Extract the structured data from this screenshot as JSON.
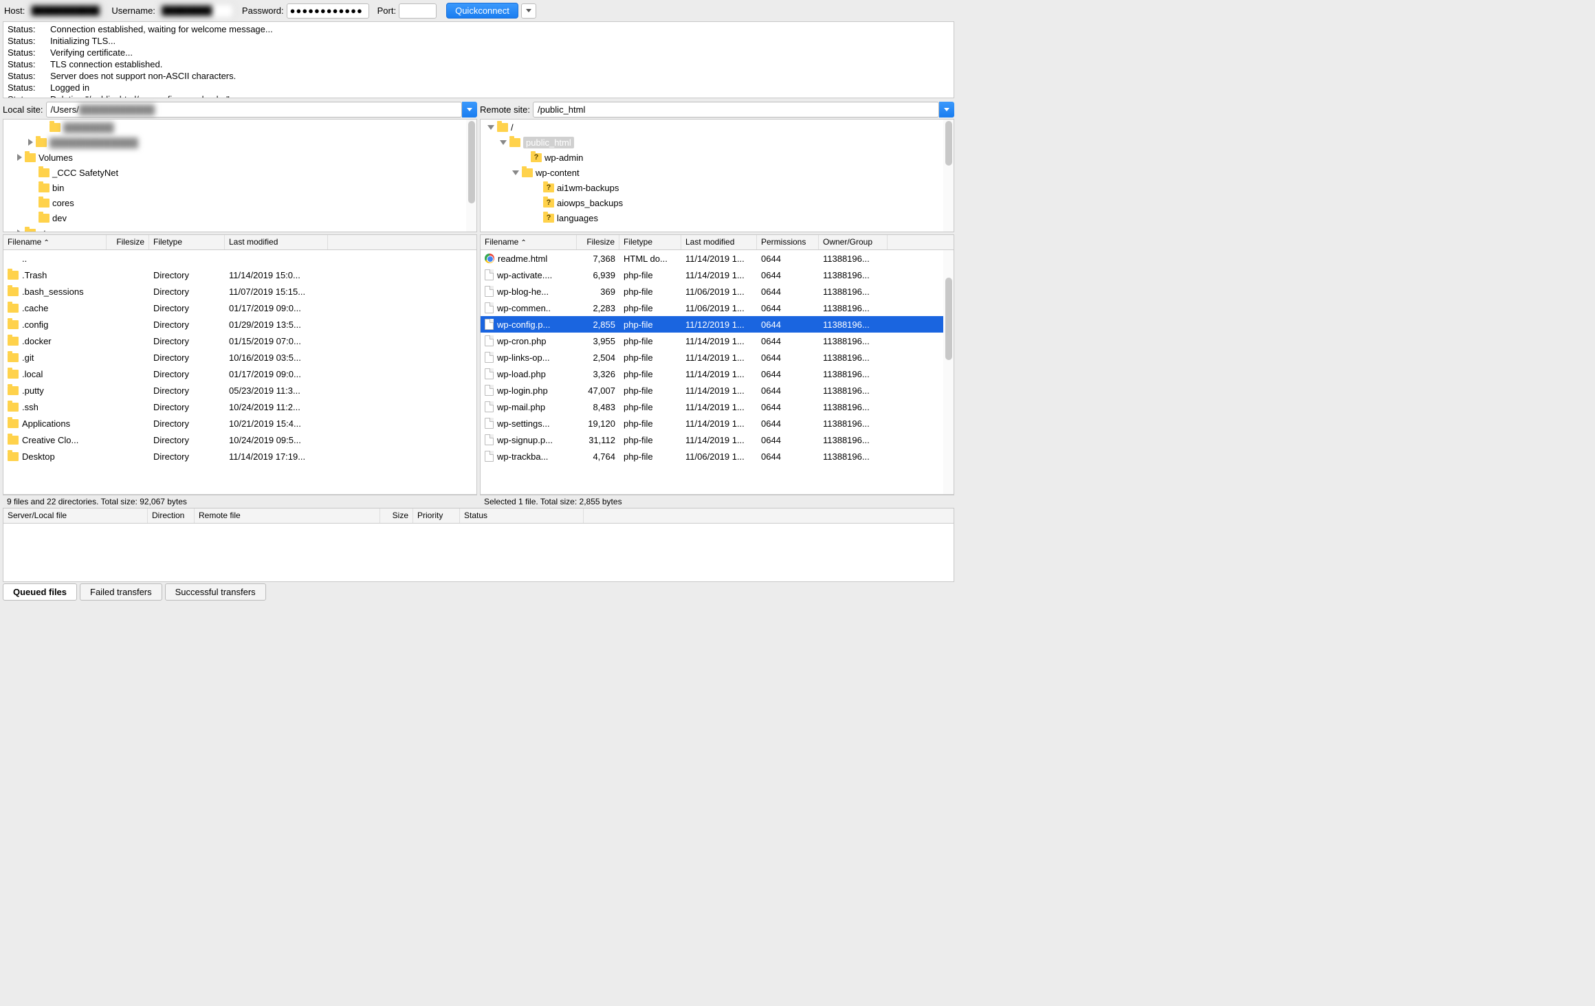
{
  "connbar": {
    "host_label": "Host:",
    "host_value": "████████████",
    "user_label": "Username:",
    "user_value": "████████",
    "pass_label": "Password:",
    "pass_value": "●●●●●●●●●●●●",
    "port_label": "Port:",
    "port_value": "",
    "quickconnect": "Quickconnect"
  },
  "log": [
    {
      "label": "Status:",
      "msg": "Connection established, waiting for welcome message..."
    },
    {
      "label": "Status:",
      "msg": "Initializing TLS..."
    },
    {
      "label": "Status:",
      "msg": "Verifying certificate..."
    },
    {
      "label": "Status:",
      "msg": "TLS connection established."
    },
    {
      "label": "Status:",
      "msg": "Server does not support non-ASCII characters."
    },
    {
      "label": "Status:",
      "msg": "Logged in"
    },
    {
      "label": "Status:",
      "msg": "Deleting \"/public_html/wp-config-sample.php\""
    }
  ],
  "local": {
    "site_label": "Local site:",
    "path_prefix": "/Users/",
    "path_blur": "████████████",
    "tree": [
      {
        "indent": 56,
        "icon": "folder",
        "label": "████████",
        "blur": true
      },
      {
        "indent": 36,
        "tri": "right",
        "icon": "folder",
        "label": "██████████████",
        "blur": true
      },
      {
        "indent": 20,
        "tri": "right",
        "icon": "folder",
        "label": "Volumes"
      },
      {
        "indent": 40,
        "icon": "folder",
        "label": "_CCC SafetyNet"
      },
      {
        "indent": 40,
        "icon": "folder",
        "label": "bin"
      },
      {
        "indent": 40,
        "icon": "folder",
        "label": "cores"
      },
      {
        "indent": 40,
        "icon": "folder",
        "label": "dev"
      },
      {
        "indent": 20,
        "tri": "right",
        "icon": "folder",
        "label": "etc"
      }
    ],
    "columns": [
      "Filename",
      "Filesize",
      "Filetype",
      "Last modified"
    ],
    "files": [
      {
        "icon": "",
        "name": "..",
        "size": "",
        "type": "",
        "mod": ""
      },
      {
        "icon": "folder",
        "name": ".Trash",
        "size": "",
        "type": "Directory",
        "mod": "11/14/2019 15:0..."
      },
      {
        "icon": "folder",
        "name": ".bash_sessions",
        "size": "",
        "type": "Directory",
        "mod": "11/07/2019 15:15..."
      },
      {
        "icon": "folder",
        "name": ".cache",
        "size": "",
        "type": "Directory",
        "mod": "01/17/2019 09:0..."
      },
      {
        "icon": "folder",
        "name": ".config",
        "size": "",
        "type": "Directory",
        "mod": "01/29/2019 13:5..."
      },
      {
        "icon": "folder",
        "name": ".docker",
        "size": "",
        "type": "Directory",
        "mod": "01/15/2019 07:0..."
      },
      {
        "icon": "folder",
        "name": ".git",
        "size": "",
        "type": "Directory",
        "mod": "10/16/2019 03:5..."
      },
      {
        "icon": "folder",
        "name": ".local",
        "size": "",
        "type": "Directory",
        "mod": "01/17/2019 09:0..."
      },
      {
        "icon": "folder",
        "name": ".putty",
        "size": "",
        "type": "Directory",
        "mod": "05/23/2019 11:3..."
      },
      {
        "icon": "folder",
        "name": ".ssh",
        "size": "",
        "type": "Directory",
        "mod": "10/24/2019 11:2..."
      },
      {
        "icon": "folder",
        "name": "Applications",
        "size": "",
        "type": "Directory",
        "mod": "10/21/2019 15:4..."
      },
      {
        "icon": "folder",
        "name": "Creative Clo...",
        "size": "",
        "type": "Directory",
        "mod": "10/24/2019 09:5..."
      },
      {
        "icon": "folder",
        "name": "Desktop",
        "size": "",
        "type": "Directory",
        "mod": "11/14/2019 17:19..."
      }
    ],
    "status": "9 files and 22 directories. Total size: 92,067 bytes"
  },
  "remote": {
    "site_label": "Remote site:",
    "path": "/public_html",
    "tree": [
      {
        "indent": 10,
        "tri": "down",
        "icon": "folder",
        "label": "/"
      },
      {
        "indent": 28,
        "tri": "down",
        "icon": "folder",
        "label": "public_html",
        "selected": true
      },
      {
        "indent": 62,
        "icon": "folderq",
        "label": "wp-admin"
      },
      {
        "indent": 46,
        "tri": "down",
        "icon": "folder",
        "label": "wp-content"
      },
      {
        "indent": 80,
        "icon": "folderq",
        "label": "ai1wm-backups"
      },
      {
        "indent": 80,
        "icon": "folderq",
        "label": "aiowps_backups"
      },
      {
        "indent": 80,
        "icon": "folderq",
        "label": "languages"
      }
    ],
    "columns": [
      "Filename",
      "Filesize",
      "Filetype",
      "Last modified",
      "Permissions",
      "Owner/Group"
    ],
    "files": [
      {
        "icon": "chrome",
        "name": "readme.html",
        "size": "7,368",
        "type": "HTML do...",
        "mod": "11/14/2019 1...",
        "perm": "0644",
        "own": "11388196..."
      },
      {
        "icon": "file",
        "name": "wp-activate....",
        "size": "6,939",
        "type": "php-file",
        "mod": "11/14/2019 1...",
        "perm": "0644",
        "own": "11388196..."
      },
      {
        "icon": "file",
        "name": "wp-blog-he...",
        "size": "369",
        "type": "php-file",
        "mod": "11/06/2019 1...",
        "perm": "0644",
        "own": "11388196..."
      },
      {
        "icon": "file",
        "name": "wp-commen..",
        "size": "2,283",
        "type": "php-file",
        "mod": "11/06/2019 1...",
        "perm": "0644",
        "own": "11388196..."
      },
      {
        "icon": "file",
        "name": "wp-config.p...",
        "size": "2,855",
        "type": "php-file",
        "mod": "11/12/2019 1...",
        "perm": "0644",
        "own": "11388196...",
        "selected": true
      },
      {
        "icon": "file",
        "name": "wp-cron.php",
        "size": "3,955",
        "type": "php-file",
        "mod": "11/14/2019 1...",
        "perm": "0644",
        "own": "11388196..."
      },
      {
        "icon": "file",
        "name": "wp-links-op...",
        "size": "2,504",
        "type": "php-file",
        "mod": "11/14/2019 1...",
        "perm": "0644",
        "own": "11388196..."
      },
      {
        "icon": "file",
        "name": "wp-load.php",
        "size": "3,326",
        "type": "php-file",
        "mod": "11/14/2019 1...",
        "perm": "0644",
        "own": "11388196..."
      },
      {
        "icon": "file",
        "name": "wp-login.php",
        "size": "47,007",
        "type": "php-file",
        "mod": "11/14/2019 1...",
        "perm": "0644",
        "own": "11388196..."
      },
      {
        "icon": "file",
        "name": "wp-mail.php",
        "size": "8,483",
        "type": "php-file",
        "mod": "11/14/2019 1...",
        "perm": "0644",
        "own": "11388196..."
      },
      {
        "icon": "file",
        "name": "wp-settings...",
        "size": "19,120",
        "type": "php-file",
        "mod": "11/14/2019 1...",
        "perm": "0644",
        "own": "11388196..."
      },
      {
        "icon": "file",
        "name": "wp-signup.p...",
        "size": "31,112",
        "type": "php-file",
        "mod": "11/14/2019 1...",
        "perm": "0644",
        "own": "11388196..."
      },
      {
        "icon": "file",
        "name": "wp-trackba...",
        "size": "4,764",
        "type": "php-file",
        "mod": "11/06/2019 1...",
        "perm": "0644",
        "own": "11388196..."
      }
    ],
    "status": "Selected 1 file. Total size: 2,855 bytes"
  },
  "queue": {
    "columns": [
      "Server/Local file",
      "Direction",
      "Remote file",
      "Size",
      "Priority",
      "Status"
    ]
  },
  "tabs": [
    "Queued files",
    "Failed transfers",
    "Successful transfers"
  ]
}
